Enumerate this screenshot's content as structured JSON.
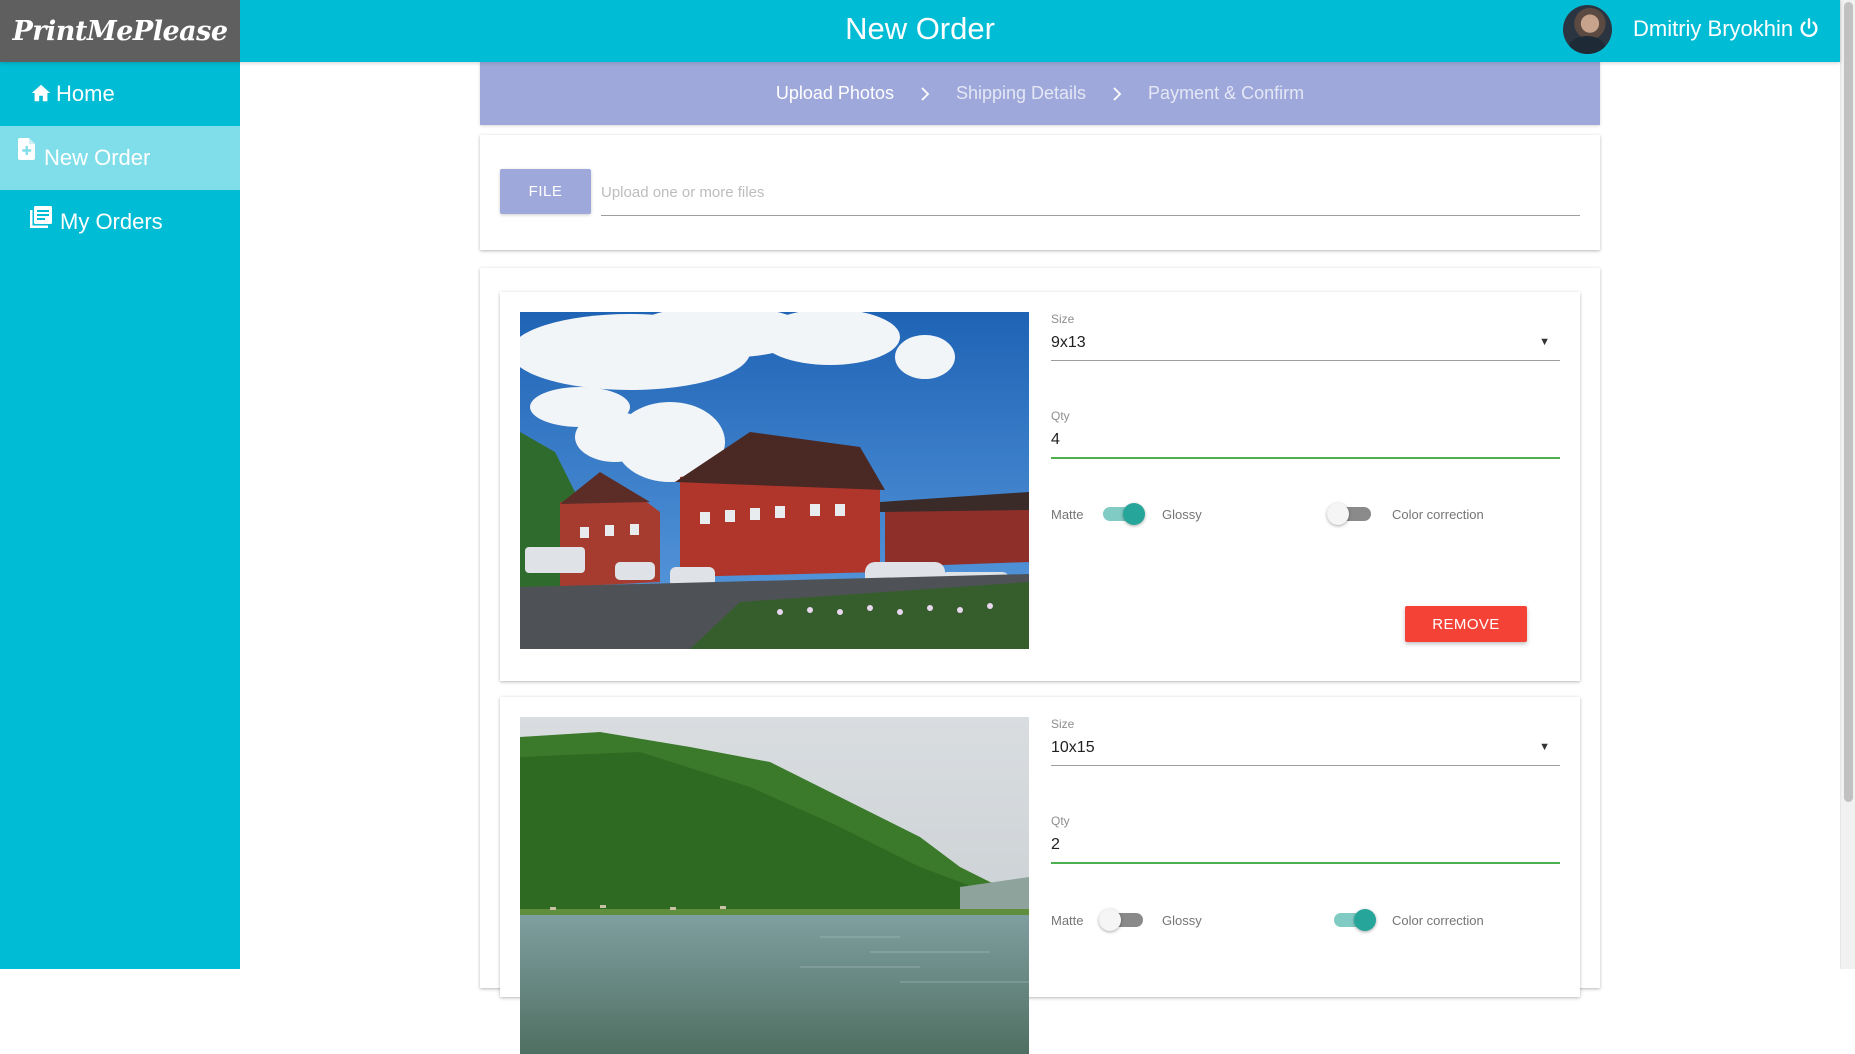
{
  "app": {
    "logo_text": "PrintMePlease",
    "title": "New Order",
    "user_name": "Dmitriy Bryokhin"
  },
  "sidebar": {
    "items": [
      {
        "label": "Home",
        "icon": "home-icon",
        "active": false
      },
      {
        "label": "New Order",
        "icon": "add-document-icon",
        "active": true
      },
      {
        "label": "My Orders",
        "icon": "orders-list-icon",
        "active": false
      }
    ]
  },
  "stepper": {
    "steps": [
      "Upload Photos",
      "Shipping Details",
      "Payment & Confirm"
    ],
    "current_step": "Upload Photos"
  },
  "upload": {
    "button_label": "FILE",
    "placeholder": "Upload one or more files"
  },
  "labels": {
    "size": "Size",
    "qty": "Qty",
    "matte": "Matte",
    "glossy": "Glossy",
    "color_correction": "Color correction",
    "remove": "REMOVE"
  },
  "photos": [
    {
      "size": "9x13",
      "qty": "4",
      "glossy": true,
      "color_correction": false
    },
    {
      "size": "10x15",
      "qty": "2",
      "glossy": false,
      "color_correction": true
    }
  ],
  "colors": {
    "primary": "#00bcd4",
    "sidebar_active": "#80deea",
    "accent": "#9fa8da",
    "danger": "#f44336",
    "toggle_on": "#26a69a",
    "qty_underline": "#4caf50"
  }
}
